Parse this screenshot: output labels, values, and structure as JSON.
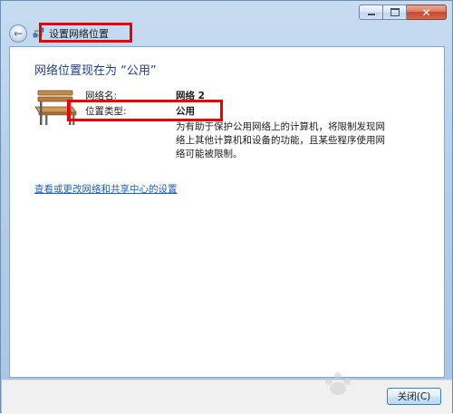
{
  "window": {
    "nav_title": "设置网络位置"
  },
  "icons": {
    "back": "back-arrow-icon",
    "network": "network-icon",
    "bench": "park-bench-icon",
    "minimize": "minimize-icon",
    "maximize": "maximize-icon",
    "close": "close-icon"
  },
  "glyphs": {
    "back": "←",
    "close": "✕"
  },
  "main": {
    "heading": "网络位置现在为 “公用”",
    "network_name_label": "网络名:",
    "network_name_value": "网络 2",
    "location_type_label": "位置类型:",
    "location_type_value": "公用",
    "description": "为有助于保护公用网络上的计算机，将限制发现网络上其他计算机和设备的功能，且某些程序使用网络可能被限制。",
    "link": "查看或更改网络和共享中心的设置"
  },
  "footer": {
    "close_button": "关闭(C)"
  },
  "colors": {
    "highlight_box": "#ee0000",
    "heading": "#1e3f87",
    "link": "#1c5fbd"
  }
}
